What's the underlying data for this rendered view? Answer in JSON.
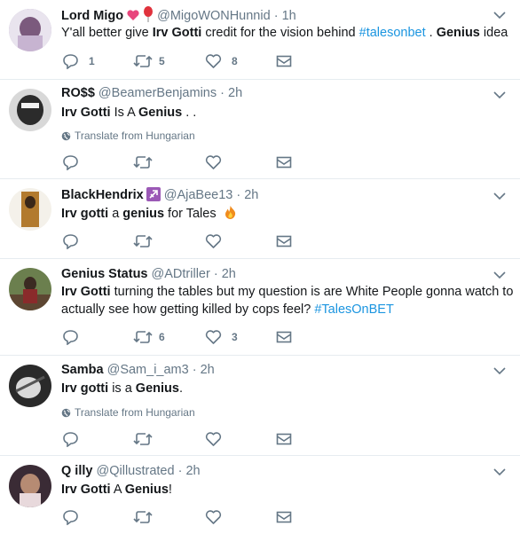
{
  "tweets": [
    {
      "name": "Lord Migo",
      "handle": "@MigoWONHunnid",
      "dot": "·",
      "time": "1h",
      "text": [
        "Y'all better give ",
        "Irv Gotti",
        " credit for the vision behind ",
        "#talesonbet",
        " . ",
        "Genius",
        " idea"
      ],
      "counts": {
        "reply": "1",
        "retweet": "5",
        "like": "8"
      }
    },
    {
      "name": "RO$$",
      "handle": "@BeamerBenjamins",
      "dot": "·",
      "time": "2h",
      "text": [
        "Irv Gotti",
        " Is A ",
        "Genius",
        " . ."
      ],
      "translate": "Translate from Hungarian"
    },
    {
      "name": "BlackHendrix",
      "handle": "@AjaBee13",
      "dot": "·",
      "time": "2h",
      "text": [
        "Irv gotti",
        " a ",
        "genius",
        " for Tales "
      ]
    },
    {
      "name": "Genius Status",
      "handle": "@ADtriller",
      "dot": "·",
      "time": "2h",
      "text": [
        "Irv Gotti",
        " turning the tables but my question is are White People gonna watch to",
        "actually see how getting killed by cops feel? ",
        "#TalesOnBET"
      ],
      "counts": {
        "retweet": "6",
        "like": "3"
      }
    },
    {
      "name": "Samba",
      "handle": "@Sam_i_am3",
      "dot": "·",
      "time": "2h",
      "text": [
        "Irv gotti",
        " is a ",
        "Genius",
        "."
      ],
      "translate": "Translate from Hungarian"
    },
    {
      "name": "Q illy",
      "handle": "@Qillustrated",
      "dot": "·",
      "time": "2h",
      "text": [
        "Irv Gotti",
        " A ",
        "Genius",
        "!"
      ]
    }
  ],
  "icons": {
    "reply": "reply-icon",
    "retweet": "retweet-icon",
    "like": "heart-icon",
    "dm": "envelope-icon",
    "caret": "chevron-down-icon",
    "globe": "globe-icon"
  },
  "colors": {
    "icon": "#657786",
    "hashtag": "#1b95e0",
    "divider": "#e6ecf0"
  }
}
